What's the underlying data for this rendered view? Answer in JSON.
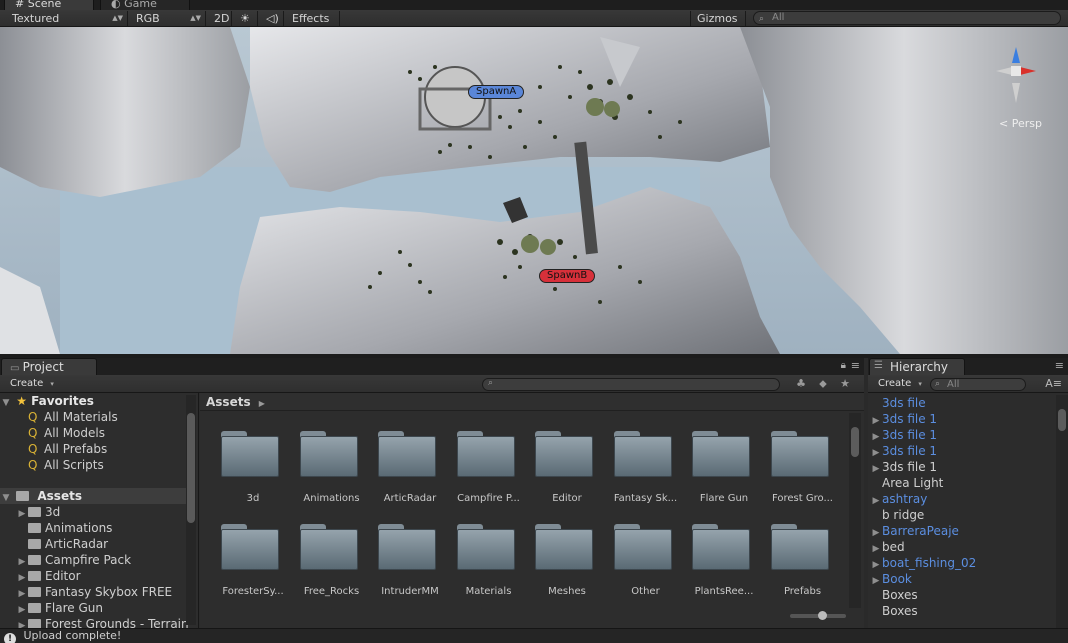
{
  "tabs": {
    "scene": "Scene",
    "game": "Game"
  },
  "scene_toolbar": {
    "render_mode": "Textured",
    "color_mode": "RGB",
    "twod": "2D",
    "effects": "Effects",
    "gizmos": "Gizmos",
    "search_placeholder": "All"
  },
  "scene": {
    "spawn_a": "SpawnA",
    "spawn_b": "SpawnB",
    "persp": "Persp",
    "spawn_a_color": "#5a86d8",
    "spawn_b_color": "#d7303a"
  },
  "project": {
    "tab": "Project",
    "create": "Create",
    "favorites": {
      "label": "Favorites",
      "items": [
        "All Materials",
        "All Models",
        "All Prefabs",
        "All Scripts"
      ]
    },
    "assets_tree": {
      "label": "Assets",
      "items": [
        "3d",
        "Animations",
        "ArticRadar",
        "Campfire Pack",
        "Editor",
        "Fantasy Skybox FREE",
        "Flare Gun",
        "Forest Grounds - Terrain"
      ]
    },
    "breadcrumb": "Assets",
    "folders": [
      "3d",
      "Animations",
      "ArticRadar",
      "Campfire P...",
      "Editor",
      "Fantasy Sk...",
      "Flare Gun",
      "Forest Gro...",
      "ForesterSy...",
      "Free_Rocks",
      "IntruderMM",
      "Materials",
      "Meshes",
      "Other",
      "PlantsRee...",
      "Prefabs"
    ]
  },
  "hierarchy": {
    "tab": "Hierarchy",
    "create": "Create",
    "search_placeholder": "All",
    "items": [
      {
        "label": "3ds file",
        "prefab": true,
        "expand": false
      },
      {
        "label": "3ds file 1",
        "prefab": true,
        "expand": true
      },
      {
        "label": "3ds file 1",
        "prefab": true,
        "expand": true
      },
      {
        "label": "3ds file 1",
        "prefab": true,
        "expand": true
      },
      {
        "label": "3ds file 1",
        "prefab": false,
        "expand": true
      },
      {
        "label": "Area Light",
        "prefab": false,
        "expand": false
      },
      {
        "label": "ashtray",
        "prefab": true,
        "expand": true
      },
      {
        "label": "b ridge",
        "prefab": false,
        "expand": false
      },
      {
        "label": "BarreraPeaje",
        "prefab": true,
        "expand": true
      },
      {
        "label": "bed",
        "prefab": false,
        "expand": true
      },
      {
        "label": "boat_fishing_02",
        "prefab": true,
        "expand": true
      },
      {
        "label": "Book",
        "prefab": true,
        "expand": true
      },
      {
        "label": "Boxes",
        "prefab": false,
        "expand": false
      },
      {
        "label": "Boxes",
        "prefab": false,
        "expand": false
      }
    ]
  },
  "status": {
    "message": "Upload complete!"
  }
}
